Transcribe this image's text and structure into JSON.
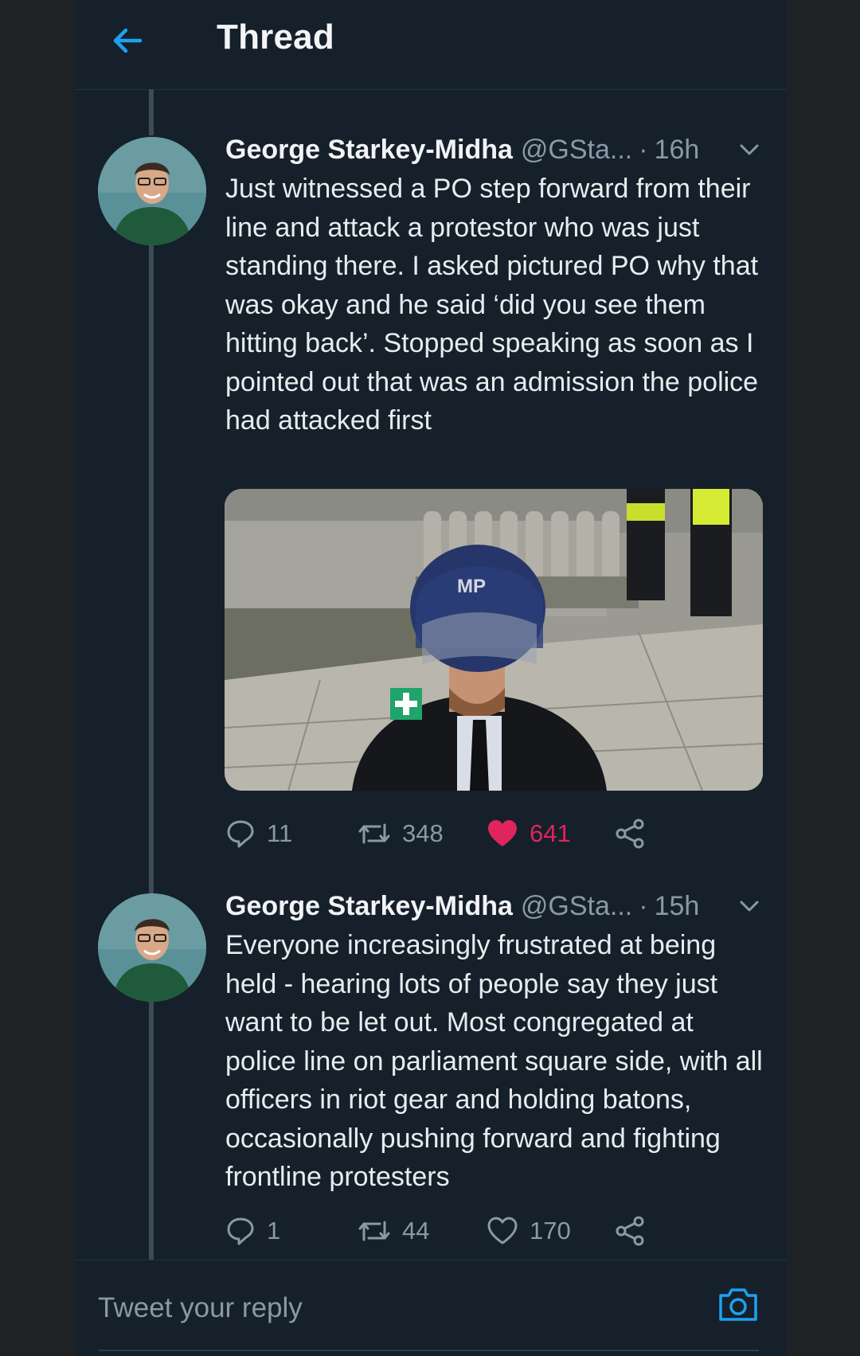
{
  "header": {
    "title": "Thread",
    "back_icon": "arrow-left-icon"
  },
  "colors": {
    "accent": "#1da1f2",
    "like": "#e0245e",
    "background": "#15202b",
    "muted": "#8b98a5"
  },
  "tweets": [
    {
      "author": "George Starkey-Midha",
      "handle": "@GSta...",
      "separator": "·",
      "time": "16h",
      "text": "Just witnessed a PO step forward from their line and attack a protestor who was just standing there. I asked pictured PO why that was okay and he said ‘did you see them hitting back’. Stopped speaking as soon as I pointed out that was an admission the police had attacked first",
      "media": {
        "helmet_text": "MP"
      },
      "replies": "11",
      "retweets": "348",
      "likes": "641",
      "liked": true
    },
    {
      "author": "George Starkey-Midha",
      "handle": "@GSta...",
      "separator": "·",
      "time": "15h",
      "text": "Everyone increasingly frustrated at being held - hearing lots of people say they just want to be let out. Most congregated at police line on parliament square side, with all officers in riot gear and holding batons, occasionally pushing forward and fighting frontline protesters",
      "replies": "1",
      "retweets": "44",
      "likes": "170",
      "liked": false
    }
  ],
  "reply_bar": {
    "placeholder": "Tweet your reply",
    "icon": "camera-icon"
  }
}
